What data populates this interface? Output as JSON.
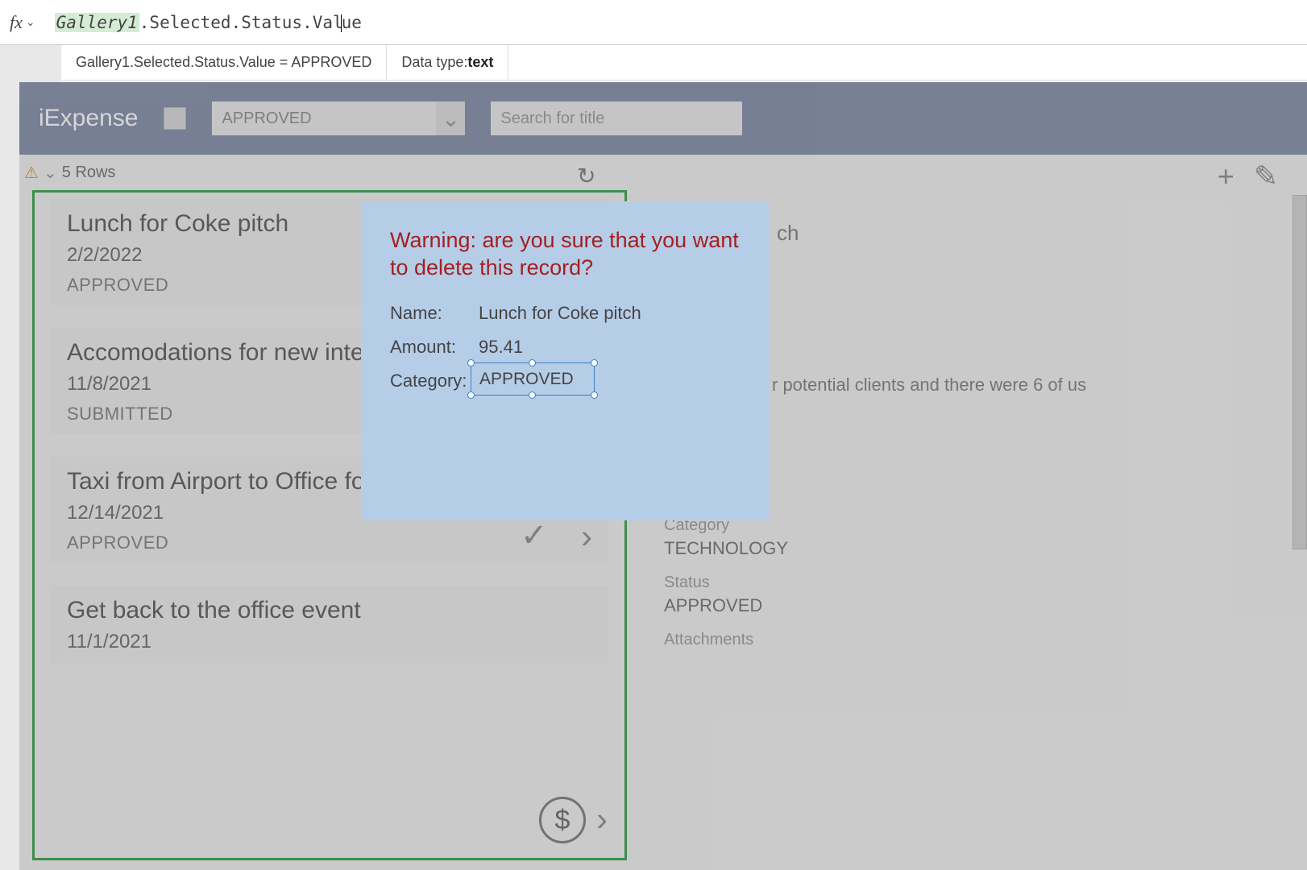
{
  "formula_bar": {
    "fx_label": "fx",
    "highlight": "Gallery1",
    "rest": ".Selected.Status.Val",
    "tail": "ue"
  },
  "result_bar": {
    "expression": "Gallery1.Selected.Status.Value  =  APPROVED",
    "datatype_label": "Data type: ",
    "datatype_value": "text"
  },
  "suggestion": "Value",
  "app": {
    "title": "iExpense",
    "dropdown_value": "APPROVED",
    "search_placeholder": "Search for title",
    "row_count": "5 Rows"
  },
  "gallery": [
    {
      "title": "Lunch for Coke pitch",
      "date": "2/2/2022",
      "status": "APPROVED"
    },
    {
      "title": "Accomodations for new interv",
      "date": "11/8/2021",
      "status": "SUBMITTED"
    },
    {
      "title": "Taxi from Airport to Office for",
      "date": "12/14/2021",
      "status": "APPROVED"
    },
    {
      "title": "Get back to the office event",
      "date": "11/1/2021",
      "status": ""
    }
  ],
  "detail": {
    "title_fragment": "ch",
    "desc_fragment": "r potential clients and there were 6 of us",
    "category_label": "Category",
    "category_value": "TECHNOLOGY",
    "status_label": "Status",
    "status_value": "APPROVED",
    "attachments_label": "Attachments"
  },
  "modal": {
    "warning": "Warning: are you sure that you want to delete this record?",
    "name_label": "Name:",
    "name_value": "Lunch for Coke pitch",
    "amount_label": "Amount:",
    "amount_value": "95.41",
    "category_label": "Category:",
    "category_value": "APPROVED"
  }
}
